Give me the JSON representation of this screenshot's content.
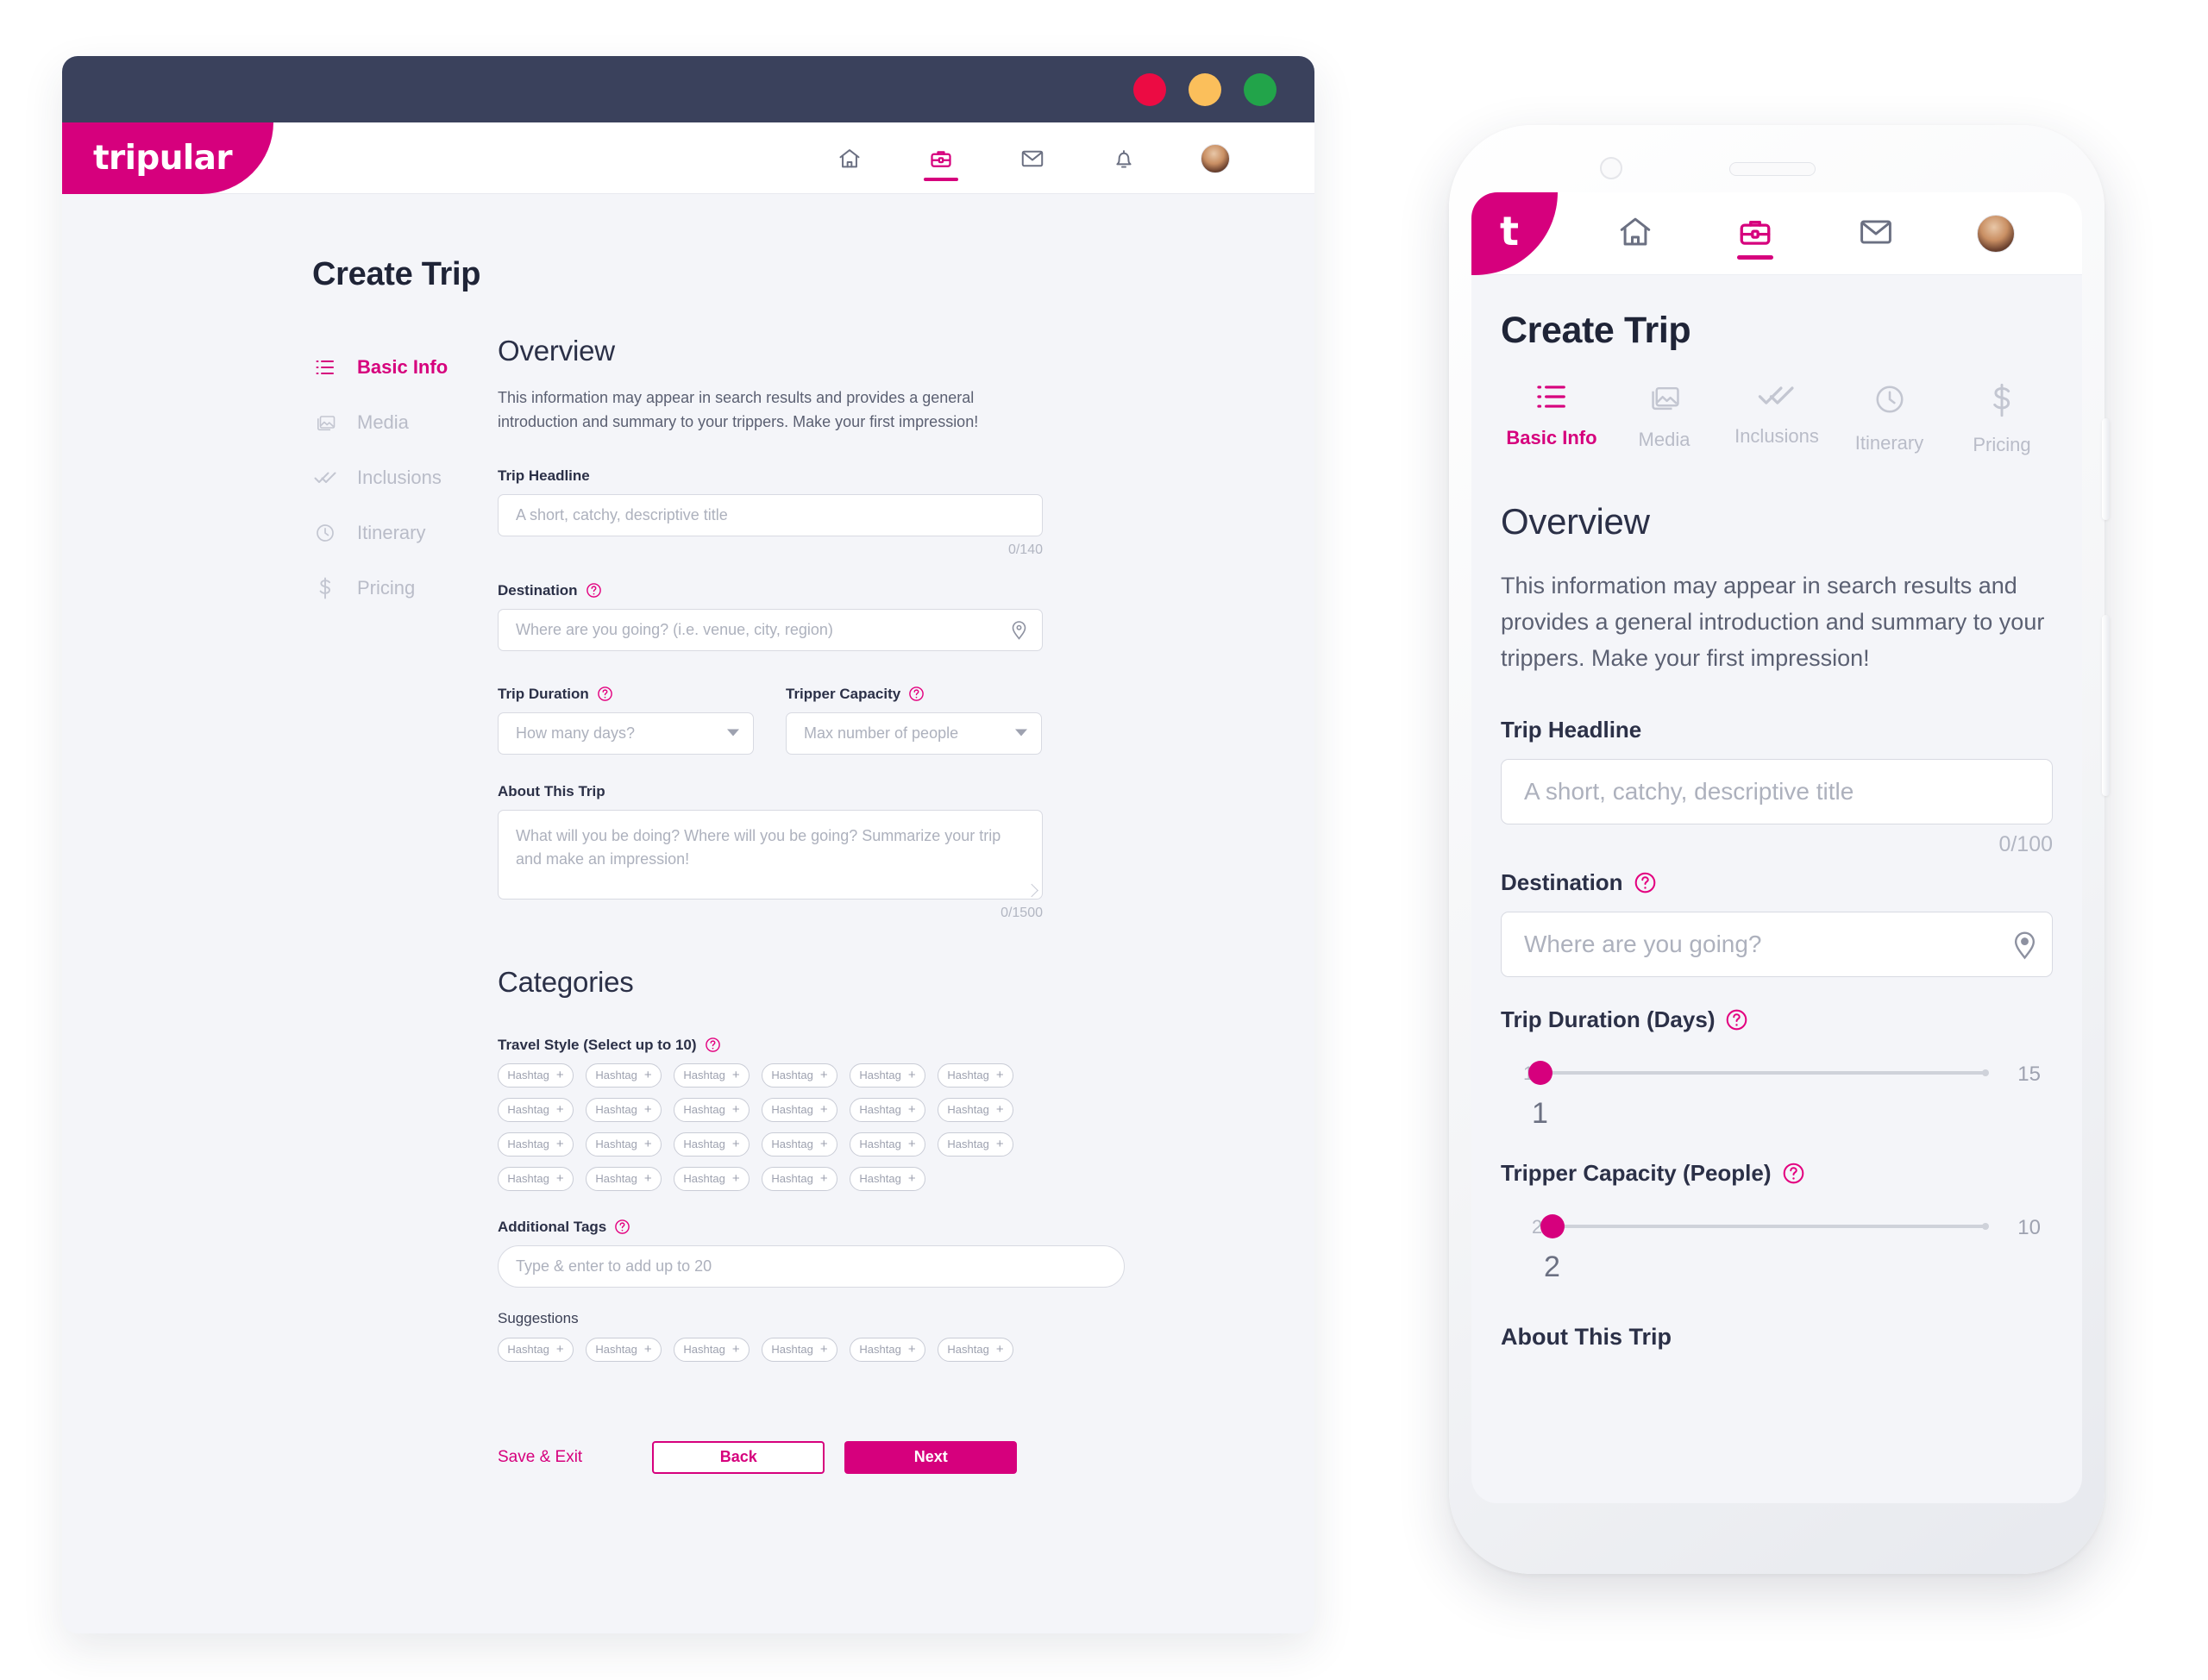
{
  "brand": {
    "name": "tripular",
    "mark": "t",
    "accent": "#d6007d"
  },
  "window": {
    "traffic_lights": [
      {
        "name": "close",
        "color": "#ec0b43"
      },
      {
        "name": "minimize",
        "color": "#fbbf5b"
      },
      {
        "name": "maximize",
        "color": "#22a44a"
      }
    ],
    "titlebar_color": "#3a415c"
  },
  "desktop": {
    "nav": [
      {
        "icon": "home-icon",
        "active": false
      },
      {
        "icon": "briefcase-icon",
        "active": true
      },
      {
        "icon": "envelope-icon",
        "active": false
      },
      {
        "icon": "bell-icon",
        "active": false
      },
      {
        "icon": "avatar",
        "active": false
      }
    ],
    "page_title": "Create Trip",
    "steps": [
      {
        "label": "Basic Info",
        "icon": "list-icon",
        "active": true
      },
      {
        "label": "Media",
        "icon": "photos-icon",
        "active": false
      },
      {
        "label": "Inclusions",
        "icon": "double-check-icon",
        "active": false
      },
      {
        "label": "Itinerary",
        "icon": "clock-icon",
        "active": false
      },
      {
        "label": "Pricing",
        "icon": "dollar-icon",
        "active": false
      }
    ],
    "overview": {
      "title": "Overview",
      "description": "This information may appear in search results and provides a general introduction and summary to your trippers. Make your first impression!",
      "headline": {
        "label": "Trip Headline",
        "placeholder": "A short, catchy, descriptive title",
        "counter": "0/140"
      },
      "destination": {
        "label": "Destination",
        "placeholder": "Where are you going? (i.e. venue, city, region)",
        "icon": "map-pin-icon"
      },
      "duration": {
        "label": "Trip Duration",
        "placeholder": "How many days?"
      },
      "capacity": {
        "label": "Tripper Capacity",
        "placeholder": "Max number of people"
      },
      "about": {
        "label": "About This Trip",
        "placeholder": "What will you be doing? Where will you be going? Summarize your trip and make an impression!",
        "counter": "0/1500"
      }
    },
    "categories": {
      "title": "Categories",
      "travel_style": {
        "label": "Travel Style (Select up to 10)",
        "pill_label": "Hashtag",
        "pill_count": 23
      },
      "additional_tags": {
        "label": "Additional Tags",
        "placeholder": "Type & enter to add up to 20"
      },
      "suggestions": {
        "label": "Suggestions",
        "pill_label": "Hashtag",
        "pill_count": 6
      }
    },
    "actions": {
      "save_exit": "Save & Exit",
      "back": "Back",
      "next": "Next"
    }
  },
  "mobile": {
    "nav": [
      {
        "icon": "home-icon",
        "active": false
      },
      {
        "icon": "briefcase-icon",
        "active": true
      },
      {
        "icon": "envelope-icon",
        "active": false
      },
      {
        "icon": "avatar",
        "active": false
      }
    ],
    "page_title": "Create Trip",
    "tabs": [
      {
        "label": "Basic Info",
        "icon": "list-icon",
        "active": true
      },
      {
        "label": "Media",
        "icon": "photos-icon",
        "active": false
      },
      {
        "label": "Inclusions",
        "icon": "double-check-icon",
        "active": false
      },
      {
        "label": "Itinerary",
        "icon": "clock-icon",
        "active": false
      },
      {
        "label": "Pricing",
        "icon": "dollar-icon",
        "active": false
      }
    ],
    "overview": {
      "title": "Overview",
      "description": "This information may appear in search results and provides a general introduction and summary to your trippers. Make your first impression!",
      "headline": {
        "label": "Trip Headline",
        "placeholder": "A short, catchy, descriptive title",
        "counter": "0/100"
      },
      "destination": {
        "label": "Destination",
        "placeholder": "Where are you going?",
        "icon": "map-pin-icon"
      },
      "duration": {
        "label": "Trip Duration (Days)",
        "min": "1",
        "max": "15",
        "value": "1"
      },
      "capacity": {
        "label": "Tripper Capacity (People)",
        "min": "2",
        "max": "10",
        "value": "2"
      },
      "about": {
        "label": "About This Trip"
      }
    }
  }
}
